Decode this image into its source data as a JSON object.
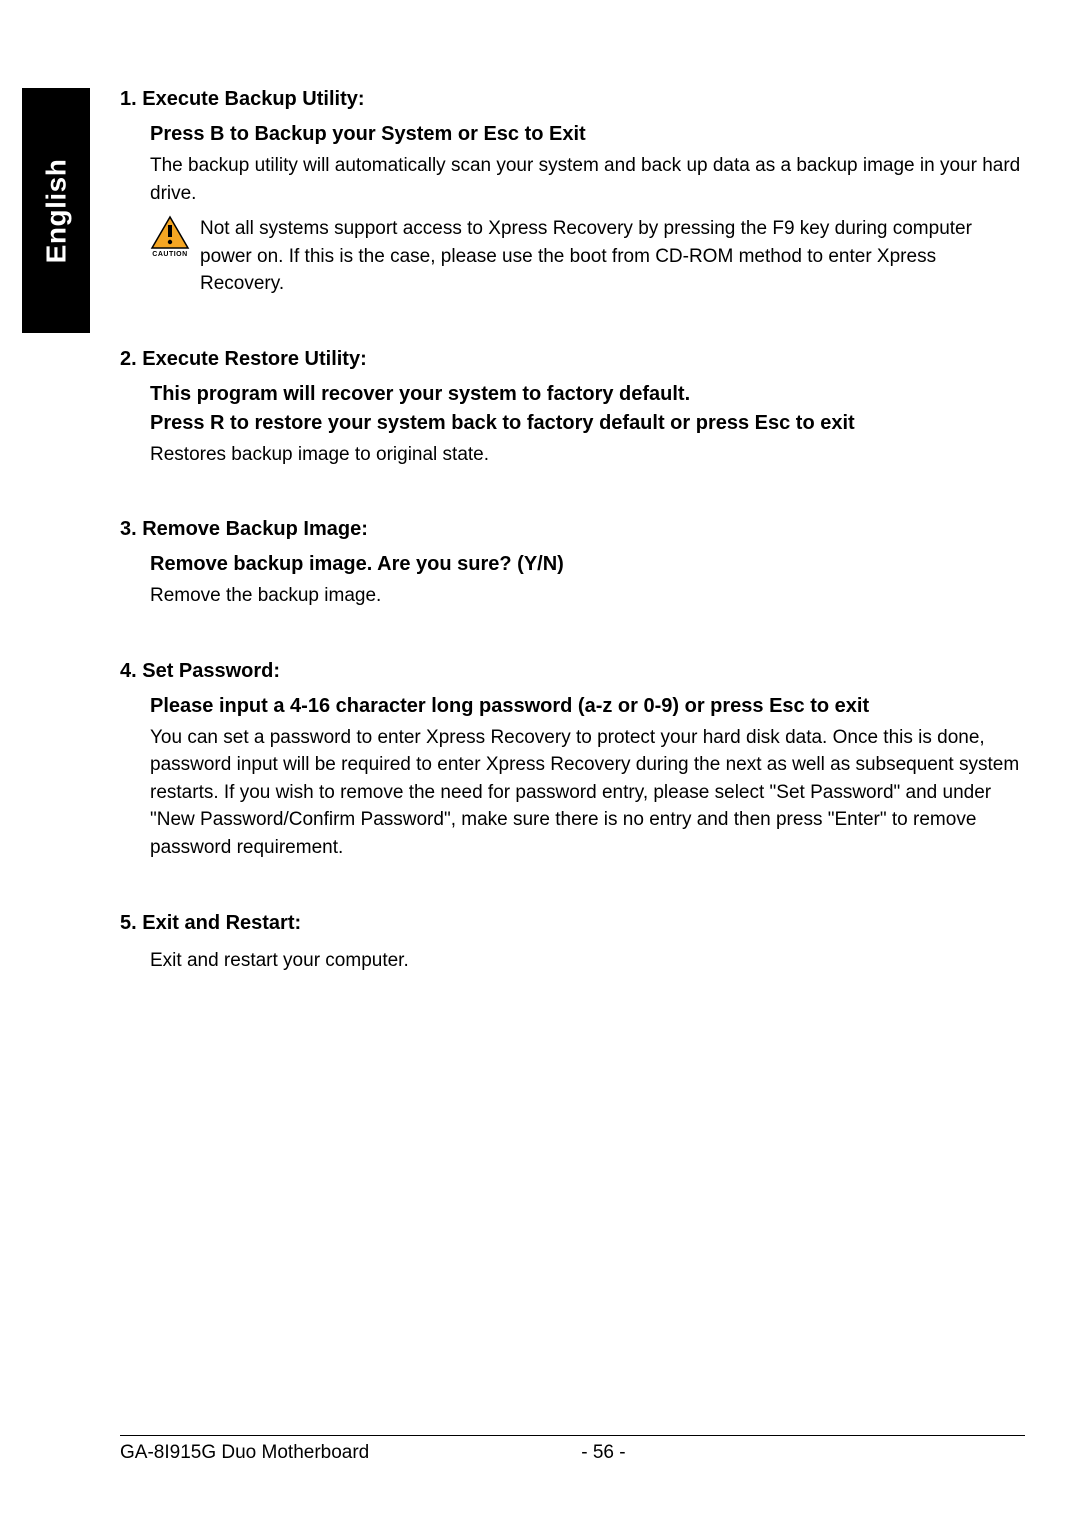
{
  "language_tab": "English",
  "sections": {
    "s1": {
      "title": "1. Execute Backup Utility:",
      "subtitle": "Press B to Backup your System or Esc to Exit",
      "body": "The backup utility will automatically scan your system and back up data as a backup image in your hard drive.",
      "caution_label": "CAUTION",
      "caution_text": "Not all systems support access to Xpress Recovery by pressing the F9 key during computer power on. If this is the case, please use the boot from CD-ROM method to enter Xpress Recovery."
    },
    "s2": {
      "title": "2. Execute Restore Utility:",
      "subtitle1": "This program will recover your system to factory default.",
      "subtitle2": "Press R to restore your system back to factory default or press Esc to exit",
      "body": "Restores backup image to original state."
    },
    "s3": {
      "title": "3. Remove Backup Image:",
      "subtitle": "Remove backup image.  Are you sure?  (Y/N)",
      "body": "Remove the backup image."
    },
    "s4": {
      "title": "4. Set Password:",
      "subtitle": "Please input a 4-16 character long password (a-z or 0-9) or press Esc to exit",
      "body": "You can set a password to enter Xpress Recovery to protect your hard disk data.  Once this is done, password input will be required to enter Xpress Recovery during the next as well as subsequent system restarts.  If you wish to remove the need for password entry, please select \"Set Password\" and under \"New Password/Confirm Password\", make sure there is no entry and then press \"Enter\" to remove password requirement."
    },
    "s5": {
      "title": "5. Exit and Restart:",
      "body": "Exit and restart your computer."
    }
  },
  "footer": {
    "product": "GA-8I915G Duo Motherboard",
    "page": "- 56 -"
  }
}
